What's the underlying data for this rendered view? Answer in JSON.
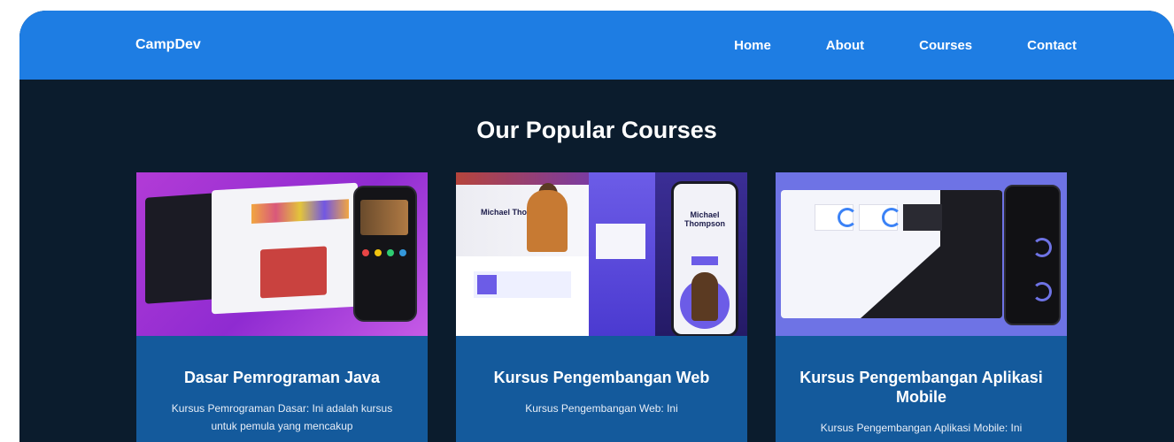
{
  "nav": {
    "brand": "CampDev",
    "links": [
      "Home",
      "About",
      "Courses",
      "Contact"
    ]
  },
  "section": {
    "title": "Our Popular Courses"
  },
  "courses": [
    {
      "title": "Dasar Pemrograman Java",
      "description": "Kursus Pemrograman Dasar: Ini adalah kursus untuk pemula yang mencakup",
      "thumbnail_label": "Java course preview"
    },
    {
      "title": "Kursus Pengembangan Web",
      "description": "Kursus Pengembangan Web: Ini",
      "thumbnail_text": "Michael Thompson",
      "thumbnail_label": "Web course preview"
    },
    {
      "title": "Kursus Pengembangan Aplikasi Mobile",
      "description": "Kursus Pengembangan Aplikasi Mobile: Ini",
      "thumbnail_label": "Mobile course preview"
    }
  ],
  "colors": {
    "navbar": "#1e7de3",
    "background": "#0b1c2d",
    "card": "#145a9c"
  }
}
